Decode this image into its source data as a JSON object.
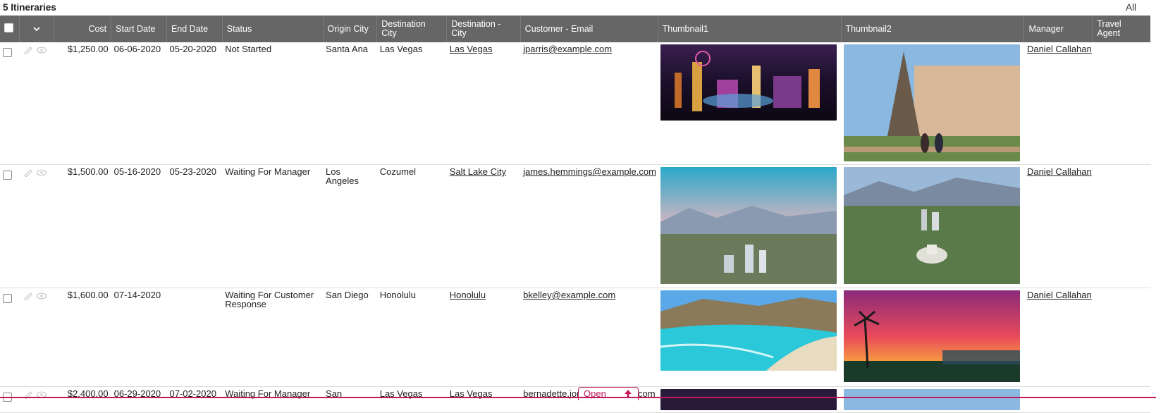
{
  "header": {
    "title": "5 Itineraries",
    "all_label": "All"
  },
  "columns": {
    "cost": "Cost",
    "start": "Start Date",
    "end": "End Date",
    "status": "Status",
    "origin": "Origin City",
    "destination": "Destination City",
    "destination_city": "Destination - City",
    "email": "Customer - Email",
    "thumb1": "Thumbnail1",
    "thumb2": "Thumbnail2",
    "manager": "Manager",
    "agent": "Travel Agent"
  },
  "rows": [
    {
      "cost": "$1,250.00",
      "start": "06-06-2020",
      "end": "05-20-2020",
      "status": "Not Started",
      "origin": "Santa Ana",
      "destination": "Las Vegas",
      "destination_city": "Las Vegas",
      "email": "jparris@example.com",
      "manager": "Daniel Callahan",
      "agent": ""
    },
    {
      "cost": "$1,500.00",
      "start": "05-16-2020",
      "end": "05-23-2020",
      "status": "Waiting For Manager",
      "origin": "Los Angeles",
      "destination": "Cozumel",
      "destination_city": "Salt Lake City",
      "email": "james.hemmings@example.com",
      "manager": "Daniel Callahan",
      "agent": ""
    },
    {
      "cost": "$1,600.00",
      "start": "07-14-2020",
      "end": "",
      "status": "Waiting For Customer Response",
      "origin": "San Diego",
      "destination": "Honolulu",
      "destination_city": "Honolulu",
      "email": "bkelley@example.com",
      "manager": "Daniel Callahan",
      "agent": ""
    },
    {
      "cost": "$2,400.00",
      "start": "06-29-2020",
      "end": "07-02-2020",
      "status": "Waiting For Manager",
      "origin": "San",
      "destination": "Las Vegas",
      "destination_city": "Las Vegas",
      "email": "bernadette.jones@example.com",
      "manager": "",
      "agent": ""
    }
  ],
  "icons": {
    "edit": "pencil-icon",
    "view": "eye-icon",
    "sort": "chevron-down-icon",
    "open_arrow": "arrow-up-icon"
  },
  "open_tab": {
    "label": "Open"
  },
  "colors": {
    "header_bg": "#666666",
    "accent": "#c2185b"
  }
}
